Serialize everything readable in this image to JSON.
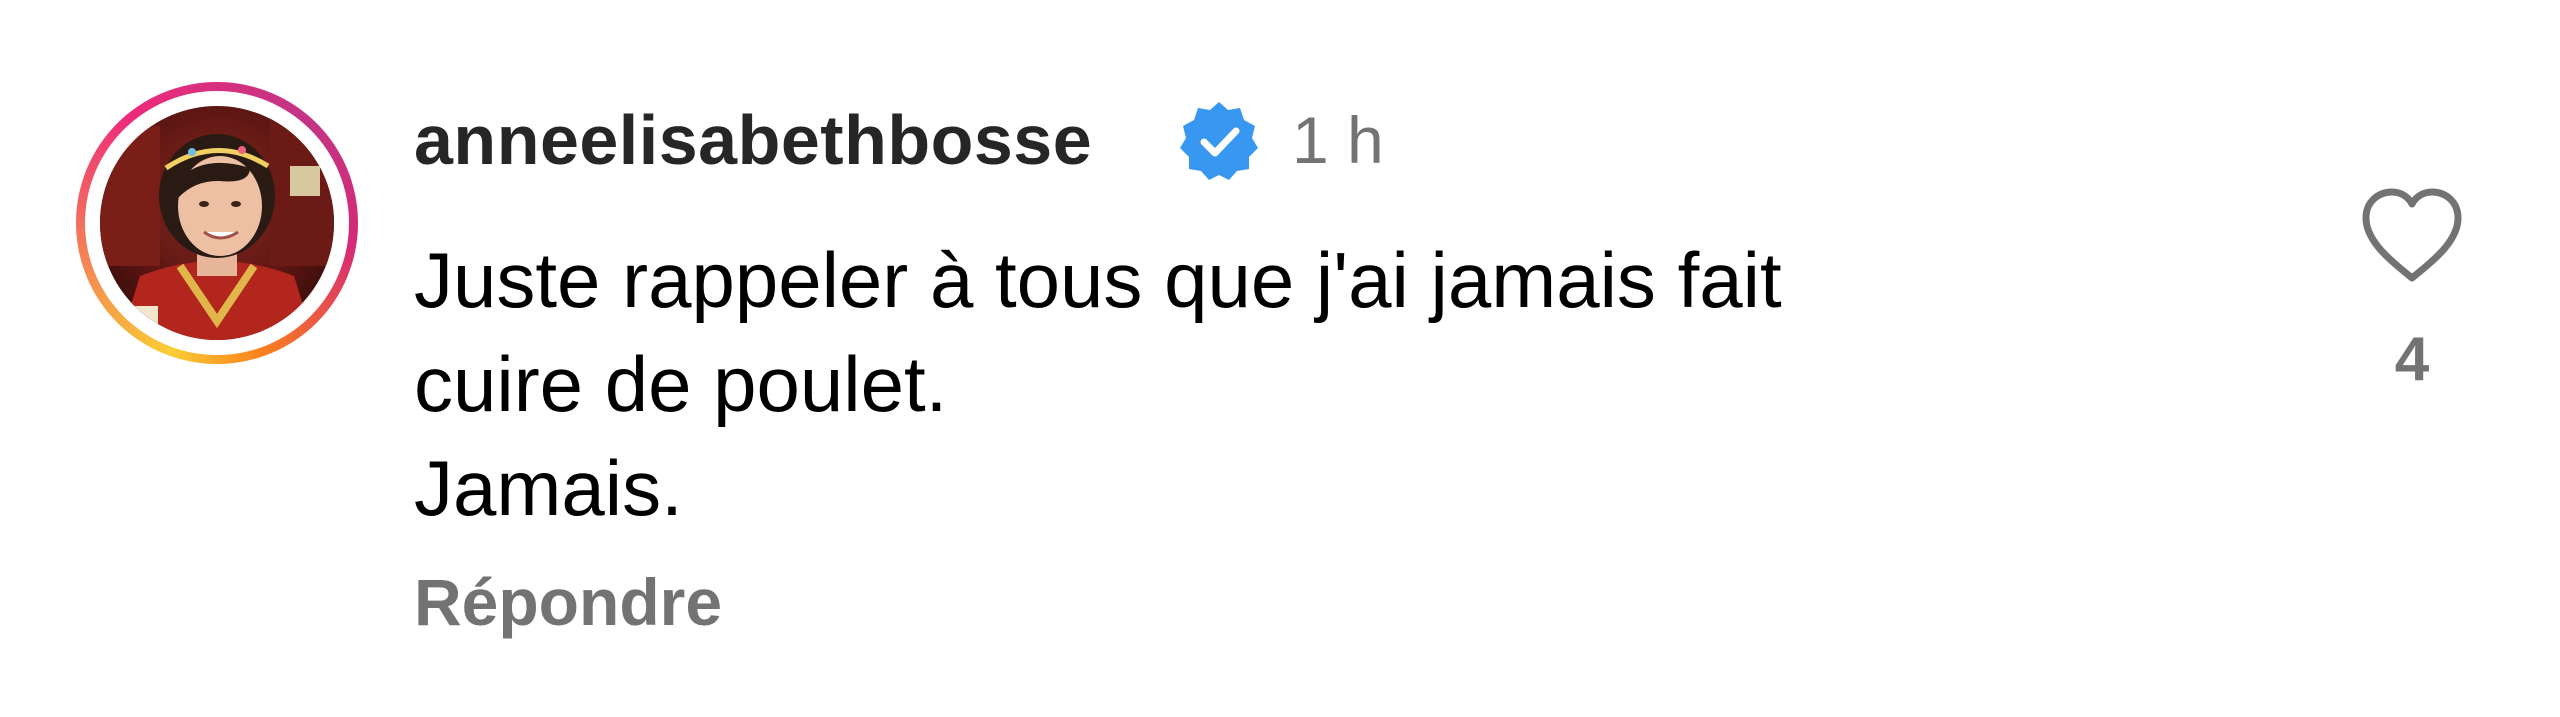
{
  "comment": {
    "username": "anneelisabethbosse",
    "verified": true,
    "verified_icon": "verified-badge-icon",
    "verified_color": "#3897f0",
    "timestamp": "1 h",
    "text_lines": [
      "Juste rappeler à tous que j'ai jamais fait",
      "cuire de poulet.",
      "Jamais."
    ],
    "reply_label": "Répondre",
    "like_icon": "heart-outline-icon",
    "like_count": "4",
    "avatar": {
      "kind": "profile-photo",
      "story_ring": true
    }
  }
}
